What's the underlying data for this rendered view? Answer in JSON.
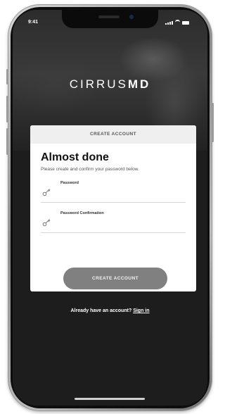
{
  "status_bar": {
    "time": "9:41"
  },
  "brand": {
    "logo_part1": "CIRRUS",
    "logo_part2": "MD"
  },
  "card": {
    "header": "CREATE ACCOUNT",
    "title": "Almost done",
    "subtitle": "Please create and confirm your password below.",
    "fields": [
      {
        "label": "Password",
        "value": "",
        "placeholder": "",
        "icon": "key-icon"
      },
      {
        "label": "Password Confirmation",
        "value": "",
        "placeholder": "",
        "icon": "key-icon"
      }
    ],
    "submit_label": "CREATE ACCOUNT"
  },
  "footer": {
    "prompt": "Already have an account?",
    "signin_label": "Sign in"
  },
  "colors": {
    "button_disabled": "#808080",
    "card_header_bg": "#efefef",
    "screen_bg": "#1d1d1d"
  }
}
